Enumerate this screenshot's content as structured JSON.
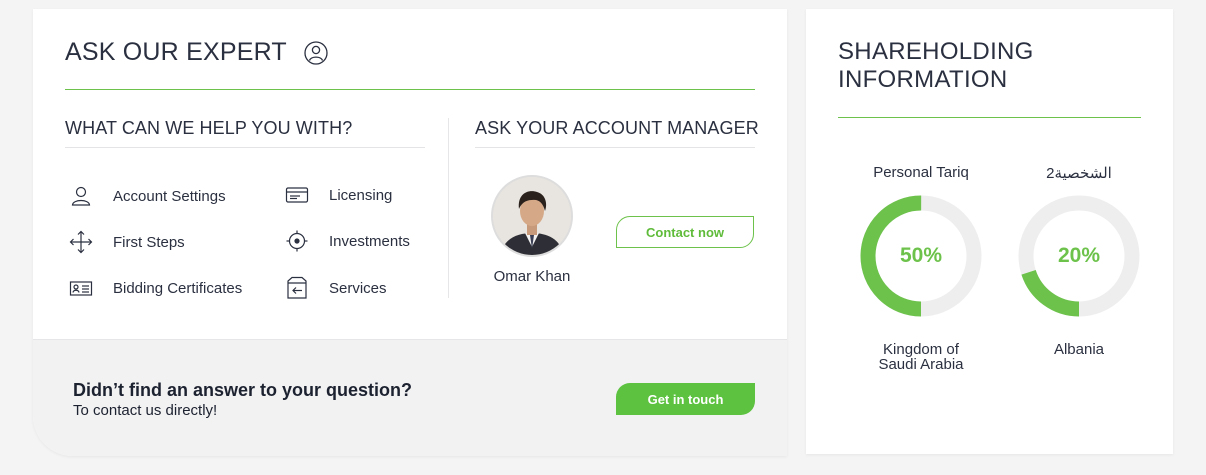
{
  "ask_expert": {
    "title": "ASK OUR EXPERT",
    "help_heading": "WHAT CAN WE HELP YOU WITH?",
    "manager_heading": "ASK YOUR ACCOUNT MANAGER",
    "help_items": [
      {
        "label": "Account Settings",
        "icon": "user-icon"
      },
      {
        "label": "Licensing",
        "icon": "card-icon"
      },
      {
        "label": "First Steps",
        "icon": "move-arrows-icon"
      },
      {
        "label": "Investments",
        "icon": "target-icon"
      },
      {
        "label": "Bidding Certificates",
        "icon": "id-card-icon"
      },
      {
        "label": "Services",
        "icon": "exit-icon"
      }
    ],
    "manager": {
      "name": "Omar Khan",
      "button": "Contact now"
    },
    "footer": {
      "heading": "Didn’t find an answer to your question?",
      "sub": "To contact us directly!",
      "button": "Get in touch"
    }
  },
  "shareholding": {
    "title_line1": "SHAREHOLDING",
    "title_line2": "INFORMATION",
    "items": [
      {
        "label": "Personal Tariq",
        "percent": 50,
        "percent_text": "50%",
        "country_line1": "Kingdom of",
        "country_line2": "Saudi Arabia"
      },
      {
        "label": "الشخصية2",
        "percent": 20,
        "percent_text": "20%",
        "country_line1": "Albania",
        "country_line2": ""
      }
    ]
  },
  "colors": {
    "accent": "#6cc24a",
    "text": "#2b3040",
    "track": "#eeeeee"
  }
}
